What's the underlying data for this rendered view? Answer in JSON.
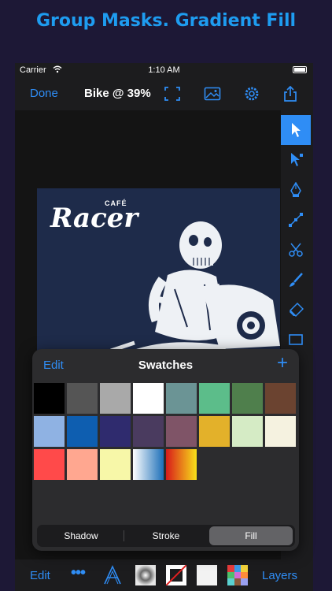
{
  "headline": "Group Masks. Gradient Fill",
  "status_bar": {
    "carrier": "Carrier",
    "time": "1:10 AM"
  },
  "nav": {
    "done_label": "Done",
    "title": "Bike @ 39%",
    "icons": [
      "fit-screen-icon",
      "image-icon",
      "settings-gear-icon",
      "share-icon"
    ]
  },
  "artwork": {
    "brand_small": "CAFÉ",
    "brand_large": "Racer"
  },
  "tools": [
    {
      "name": "selection-arrow-icon",
      "active": true
    },
    {
      "name": "direct-selection-icon",
      "active": false
    },
    {
      "name": "pen-tool-icon",
      "active": false
    },
    {
      "name": "node-tool-icon",
      "active": false
    },
    {
      "name": "scissors-icon",
      "active": false
    },
    {
      "name": "brush-icon",
      "active": false
    },
    {
      "name": "eraser-icon",
      "active": false
    },
    {
      "name": "rectangle-icon",
      "active": false
    }
  ],
  "swatches_popover": {
    "edit_label": "Edit",
    "title": "Swatches",
    "add_label": "+",
    "swatches": [
      {
        "color": "#000000"
      },
      {
        "color": "#555555"
      },
      {
        "color": "#a9a9a9"
      },
      {
        "color": "#ffffff"
      },
      {
        "color": "#6b9495"
      },
      {
        "color": "#5cbd8a"
      },
      {
        "color": "#4f7f4c"
      },
      {
        "color": "#6b4330"
      },
      {
        "color": "#8fb2e3"
      },
      {
        "color": "#0e5eb0"
      },
      {
        "color": "#2f2b6e"
      },
      {
        "color": "#4a3b5f"
      },
      {
        "color": "#7f5467"
      },
      {
        "color": "#e3b12a"
      },
      {
        "color": "#d5ebc5"
      },
      {
        "color": "#f5f2e0"
      },
      {
        "color": "#ff4a4a"
      },
      {
        "color": "#ffa790"
      },
      {
        "color": "#f7f7a8"
      },
      {
        "gradient": [
          "#ffffff",
          "#1c6fb8"
        ]
      },
      {
        "gradient": [
          "#d81a1a",
          "#f7e11a"
        ]
      }
    ],
    "segments": [
      "Shadow",
      "Stroke",
      "Fill"
    ],
    "selected_segment": "Fill"
  },
  "bottom_bar": {
    "edit_label": "Edit",
    "more_label": "•••",
    "layers_label": "Layers",
    "items": [
      "text-tool-icon",
      "gradient-preview-icon",
      "stroke-none-icon",
      "fill-white-icon",
      "swatch-palette-icon"
    ]
  },
  "colors": {
    "accent": "#2f8df5",
    "headline": "#1e9cf0",
    "background": "#1d1836"
  }
}
